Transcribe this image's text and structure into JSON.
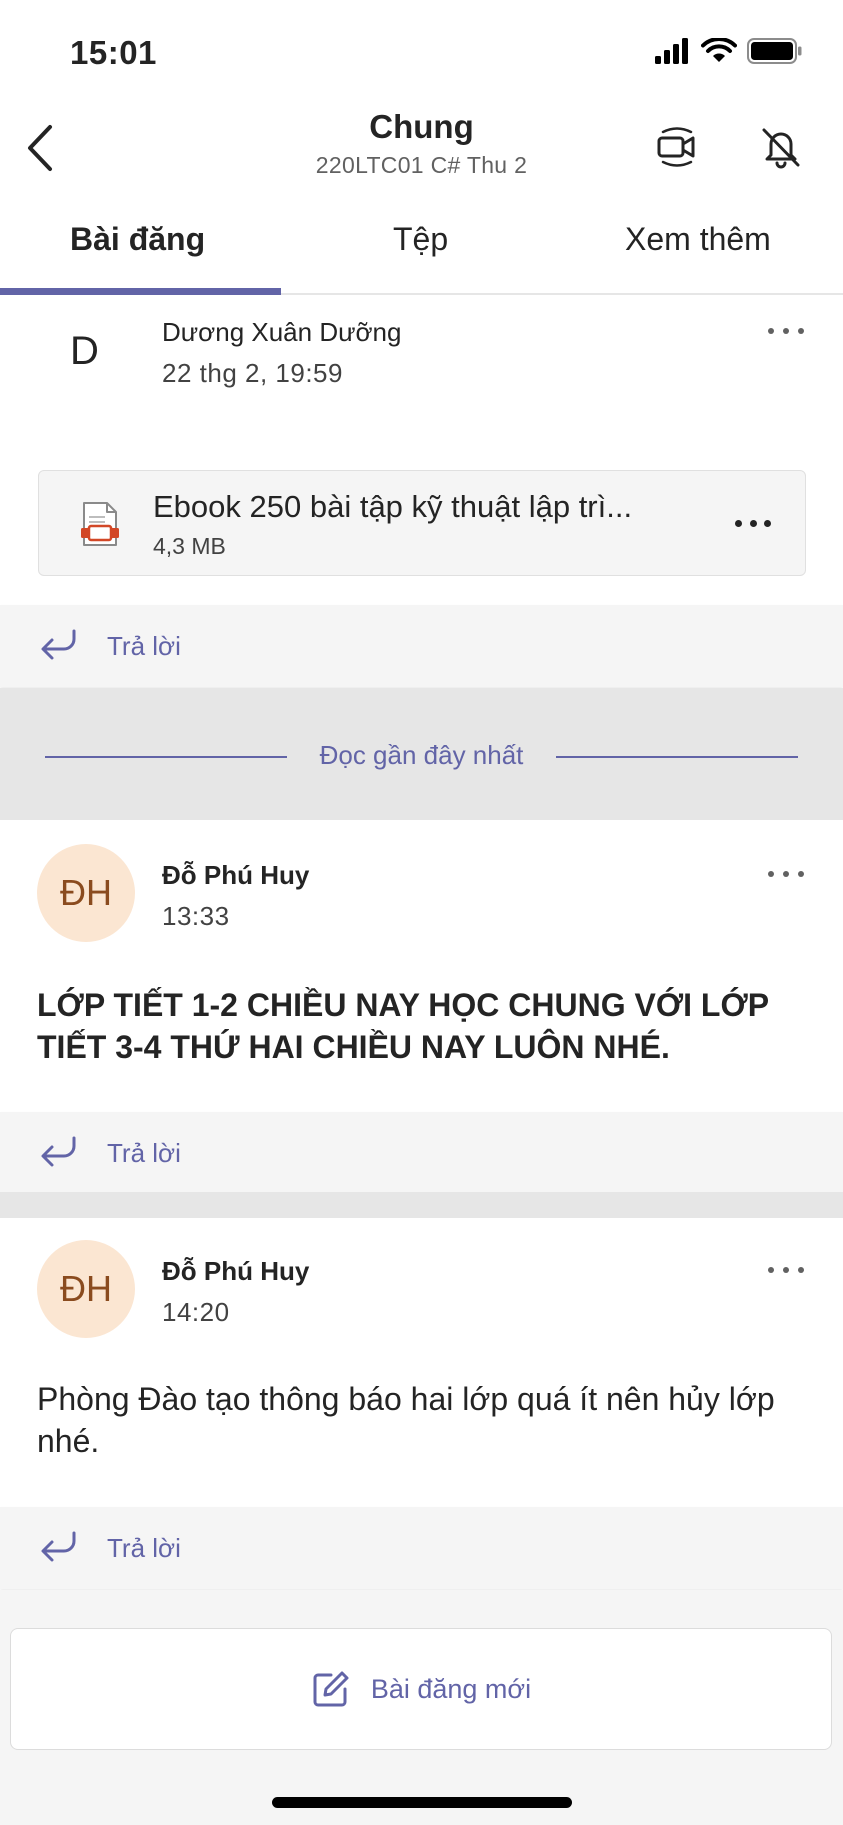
{
  "status_bar": {
    "time": "15:01"
  },
  "header": {
    "title": "Chung",
    "subtitle": "220LTC01 C# Thu 2",
    "icons": [
      "back-icon",
      "video-meet-icon",
      "bell-off-icon"
    ]
  },
  "tabs": [
    {
      "label": "Bài đăng",
      "active": true
    },
    {
      "label": "Tệp",
      "active": false
    },
    {
      "label": "Xem thêm",
      "active": false
    }
  ],
  "posts": [
    {
      "avatar": "D",
      "author": "Dương Xuân Dưỡng",
      "time": "22 thg 2, 19:59",
      "attachment": {
        "name": "Ebook 250 bài tập kỹ thuật lập trì...",
        "size": "4,3 MB"
      },
      "reply_label": "Trả lời"
    },
    {
      "avatar": "ĐH",
      "author": "Đỗ Phú Huy",
      "time": "13:33",
      "body": "LỚP TIẾT 1-2 CHIỀU NAY HỌC CHUNG VỚI LỚP TIẾT 3-4 THỨ HAI CHIỀU NAY LUÔN NHÉ.",
      "reply_label": "Trả lời"
    },
    {
      "avatar": "ĐH",
      "author": "Đỗ Phú Huy",
      "time": "14:20",
      "body": "Phòng Đào tạo thông báo hai lớp quá ít nên hủy lớp nhé.",
      "reply_label": "Trả lời"
    }
  ],
  "separator": {
    "label": "Đọc gần đây nhất"
  },
  "new_post": {
    "label": "Bài đăng mới"
  },
  "colors": {
    "accent": "#6264a7",
    "avatar_bg": "#fbe6d2",
    "avatar_text": "#8a4b1e"
  }
}
